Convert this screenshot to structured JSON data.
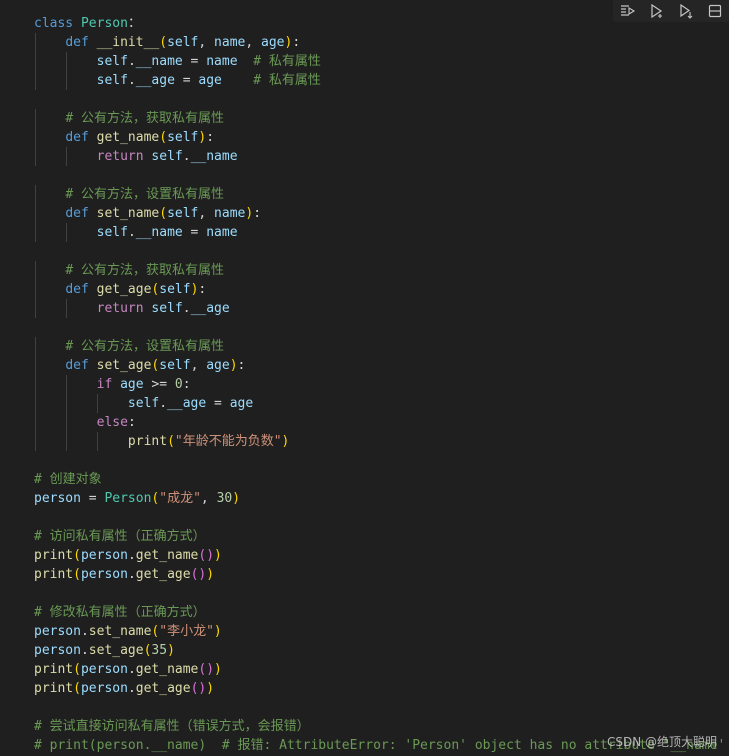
{
  "toolbar": {
    "buttons": [
      {
        "name": "run-by-line-icon"
      },
      {
        "name": "run-next-icon"
      },
      {
        "name": "run-below-icon"
      },
      {
        "name": "split-cell-icon"
      }
    ]
  },
  "code": {
    "lines": [
      [
        [
          "kw",
          "class "
        ],
        [
          "cls",
          "Person"
        ],
        [
          "",
          "："
        ]
      ],
      [
        [
          "",
          "    "
        ],
        [
          "kw",
          "def "
        ],
        [
          "fn",
          "__init__"
        ],
        [
          "p1",
          "("
        ],
        [
          "var",
          "self"
        ],
        [
          "",
          ", "
        ],
        [
          "var",
          "name"
        ],
        [
          "",
          ", "
        ],
        [
          "var",
          "age"
        ],
        [
          "p1",
          ")"
        ],
        [
          "",
          ":"
        ]
      ],
      [
        [
          "",
          "        "
        ],
        [
          "var",
          "self"
        ],
        [
          "",
          "."
        ],
        [
          "var",
          "__name"
        ],
        [
          "",
          " = "
        ],
        [
          "var",
          "name"
        ],
        [
          "",
          "  "
        ],
        [
          "cmt",
          "# 私有属性"
        ]
      ],
      [
        [
          "",
          "        "
        ],
        [
          "var",
          "self"
        ],
        [
          "",
          "."
        ],
        [
          "var",
          "__age"
        ],
        [
          "",
          " = "
        ],
        [
          "var",
          "age"
        ],
        [
          "",
          "    "
        ],
        [
          "cmt",
          "# 私有属性"
        ]
      ],
      [],
      [
        [
          "",
          "    "
        ],
        [
          "cmt",
          "# 公有方法，获取私有属性"
        ]
      ],
      [
        [
          "",
          "    "
        ],
        [
          "kw",
          "def "
        ],
        [
          "fn",
          "get_name"
        ],
        [
          "p1",
          "("
        ],
        [
          "var",
          "self"
        ],
        [
          "p1",
          ")"
        ],
        [
          "",
          ":"
        ]
      ],
      [
        [
          "",
          "        "
        ],
        [
          "ctrl",
          "return "
        ],
        [
          "var",
          "self"
        ],
        [
          "",
          "."
        ],
        [
          "var",
          "__name"
        ]
      ],
      [],
      [
        [
          "",
          "    "
        ],
        [
          "cmt",
          "# 公有方法，设置私有属性"
        ]
      ],
      [
        [
          "",
          "    "
        ],
        [
          "kw",
          "def "
        ],
        [
          "fn",
          "set_name"
        ],
        [
          "p1",
          "("
        ],
        [
          "var",
          "self"
        ],
        [
          "",
          ", "
        ],
        [
          "var",
          "name"
        ],
        [
          "p1",
          ")"
        ],
        [
          "",
          ":"
        ]
      ],
      [
        [
          "",
          "        "
        ],
        [
          "var",
          "self"
        ],
        [
          "",
          "."
        ],
        [
          "var",
          "__name"
        ],
        [
          "",
          " = "
        ],
        [
          "var",
          "name"
        ]
      ],
      [],
      [
        [
          "",
          "    "
        ],
        [
          "cmt",
          "# 公有方法，获取私有属性"
        ]
      ],
      [
        [
          "",
          "    "
        ],
        [
          "kw",
          "def "
        ],
        [
          "fn",
          "get_age"
        ],
        [
          "p1",
          "("
        ],
        [
          "var",
          "self"
        ],
        [
          "p1",
          ")"
        ],
        [
          "",
          ":"
        ]
      ],
      [
        [
          "",
          "        "
        ],
        [
          "ctrl",
          "return "
        ],
        [
          "var",
          "self"
        ],
        [
          "",
          "."
        ],
        [
          "var",
          "__age"
        ]
      ],
      [],
      [
        [
          "",
          "    "
        ],
        [
          "cmt",
          "# 公有方法，设置私有属性"
        ]
      ],
      [
        [
          "",
          "    "
        ],
        [
          "kw",
          "def "
        ],
        [
          "fn",
          "set_age"
        ],
        [
          "p1",
          "("
        ],
        [
          "var",
          "self"
        ],
        [
          "",
          ", "
        ],
        [
          "var",
          "age"
        ],
        [
          "p1",
          ")"
        ],
        [
          "",
          ":"
        ]
      ],
      [
        [
          "",
          "        "
        ],
        [
          "ctrl",
          "if "
        ],
        [
          "var",
          "age"
        ],
        [
          "",
          " >= "
        ],
        [
          "num",
          "0"
        ],
        [
          "",
          ":"
        ]
      ],
      [
        [
          "",
          "            "
        ],
        [
          "var",
          "self"
        ],
        [
          "",
          "."
        ],
        [
          "var",
          "__age"
        ],
        [
          "",
          " = "
        ],
        [
          "var",
          "age"
        ]
      ],
      [
        [
          "",
          "        "
        ],
        [
          "ctrl",
          "else"
        ],
        [
          "",
          ":"
        ]
      ],
      [
        [
          "",
          "            "
        ],
        [
          "fn",
          "print"
        ],
        [
          "p1",
          "("
        ],
        [
          "str",
          "\"年龄不能为负数\""
        ],
        [
          "p1",
          ")"
        ]
      ],
      [],
      [
        [
          "cmt",
          "# 创建对象"
        ]
      ],
      [
        [
          "var",
          "person"
        ],
        [
          "",
          " = "
        ],
        [
          "cls",
          "Person"
        ],
        [
          "p1",
          "("
        ],
        [
          "str",
          "\"成龙\""
        ],
        [
          "",
          ", "
        ],
        [
          "num",
          "30"
        ],
        [
          "p1",
          ")"
        ]
      ],
      [],
      [
        [
          "cmt",
          "# 访问私有属性（正确方式）"
        ]
      ],
      [
        [
          "fn",
          "print"
        ],
        [
          "p1",
          "("
        ],
        [
          "var",
          "person"
        ],
        [
          "",
          "."
        ],
        [
          "fn",
          "get_name"
        ],
        [
          "p2",
          "()"
        ],
        [
          "p1",
          ")"
        ]
      ],
      [
        [
          "fn",
          "print"
        ],
        [
          "p1",
          "("
        ],
        [
          "var",
          "person"
        ],
        [
          "",
          "."
        ],
        [
          "fn",
          "get_age"
        ],
        [
          "p2",
          "()"
        ],
        [
          "p1",
          ")"
        ]
      ],
      [],
      [
        [
          "cmt",
          "# 修改私有属性（正确方式）"
        ]
      ],
      [
        [
          "var",
          "person"
        ],
        [
          "",
          "."
        ],
        [
          "fn",
          "set_name"
        ],
        [
          "p1",
          "("
        ],
        [
          "str",
          "\"李小龙\""
        ],
        [
          "p1",
          ")"
        ]
      ],
      [
        [
          "var",
          "person"
        ],
        [
          "",
          "."
        ],
        [
          "fn",
          "set_age"
        ],
        [
          "p1",
          "("
        ],
        [
          "num",
          "35"
        ],
        [
          "p1",
          ")"
        ]
      ],
      [
        [
          "fn",
          "print"
        ],
        [
          "p1",
          "("
        ],
        [
          "var",
          "person"
        ],
        [
          "",
          "."
        ],
        [
          "fn",
          "get_name"
        ],
        [
          "p2",
          "()"
        ],
        [
          "p1",
          ")"
        ]
      ],
      [
        [
          "fn",
          "print"
        ],
        [
          "p1",
          "("
        ],
        [
          "var",
          "person"
        ],
        [
          "",
          "."
        ],
        [
          "fn",
          "get_age"
        ],
        [
          "p2",
          "()"
        ],
        [
          "p1",
          ")"
        ]
      ],
      [],
      [
        [
          "cmt",
          "# 尝试直接访问私有属性（错误方式，会报错）"
        ]
      ],
      [
        [
          "cmt",
          "# print(person.__name)  # 报错: AttributeError: 'Person' object has no attribute '__name'"
        ]
      ]
    ],
    "guides": [
      [],
      [
        1
      ],
      [
        1,
        2
      ],
      [
        1,
        2
      ],
      [
        1
      ],
      [
        1
      ],
      [
        1
      ],
      [
        1,
        2
      ],
      [
        1
      ],
      [
        1
      ],
      [
        1
      ],
      [
        1,
        2
      ],
      [
        1
      ],
      [
        1
      ],
      [
        1
      ],
      [
        1,
        2
      ],
      [
        1
      ],
      [
        1
      ],
      [
        1
      ],
      [
        1,
        2
      ],
      [
        1,
        2,
        3
      ],
      [
        1,
        2
      ],
      [
        1,
        2,
        3
      ],
      [],
      [],
      [],
      [],
      [],
      [],
      [],
      [],
      [],
      [],
      [],
      [],
      [],
      [],
      [],
      []
    ]
  },
  "watermark": "CSDN @绝顶大聪明"
}
